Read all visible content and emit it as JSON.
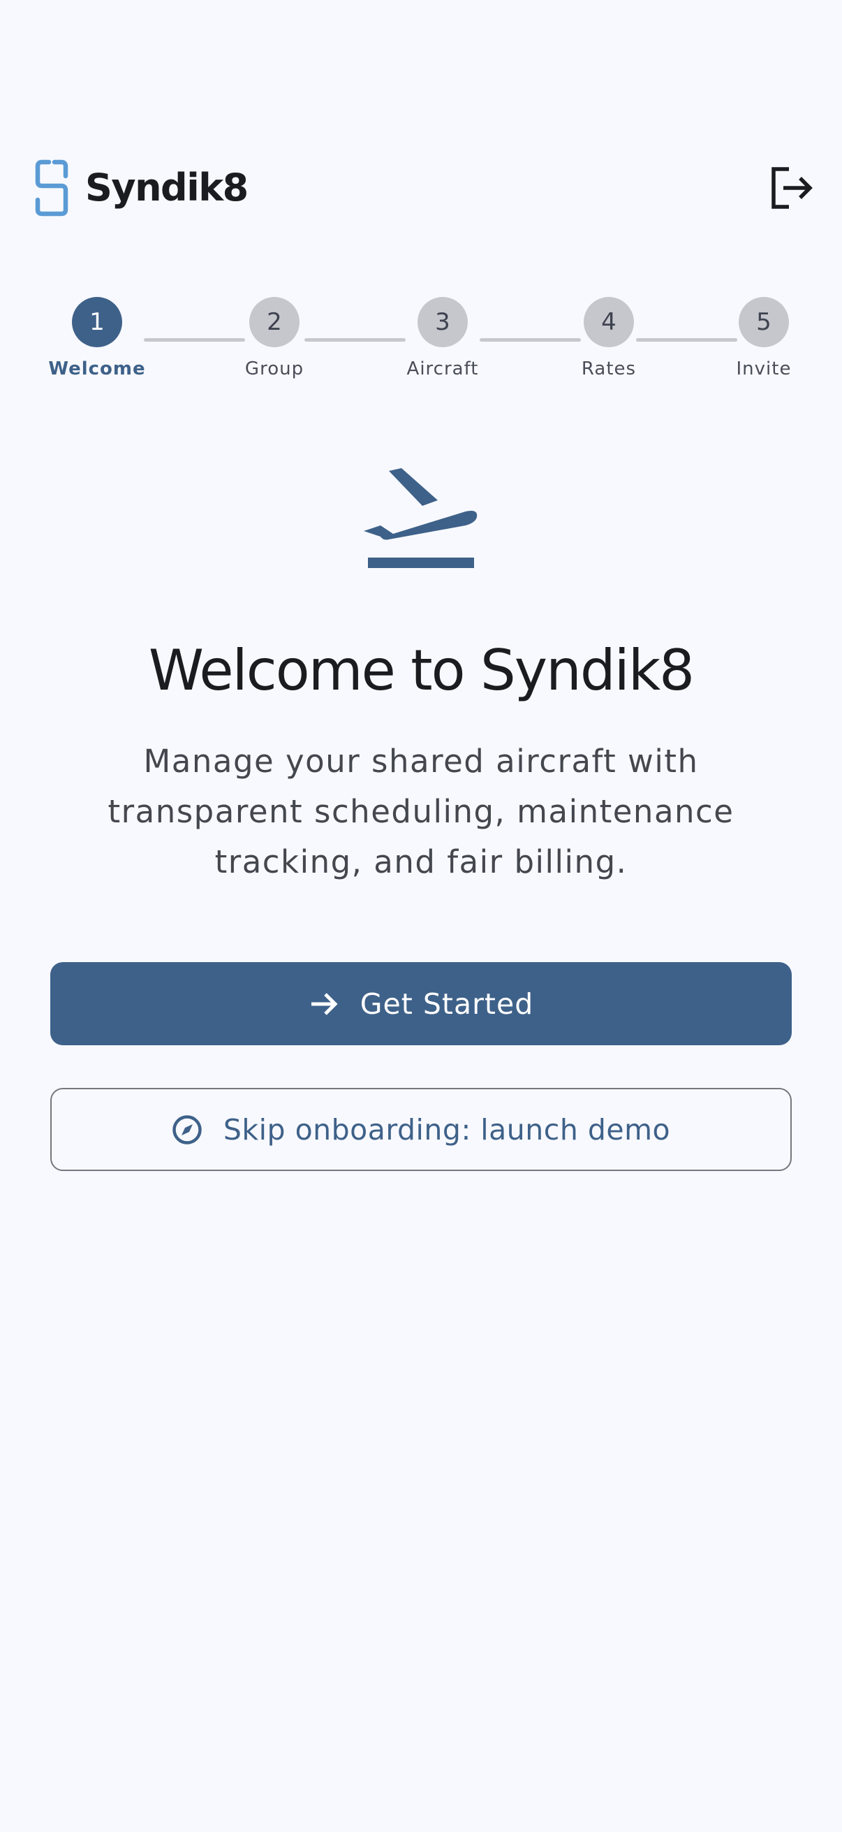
{
  "header": {
    "brand": "Syndik8",
    "logo_icon": "syndik8-logo-icon",
    "logout_icon": "logout-icon"
  },
  "stepper": {
    "steps": [
      {
        "number": "1",
        "label": "Welcome",
        "active": true
      },
      {
        "number": "2",
        "label": "Group",
        "active": false
      },
      {
        "number": "3",
        "label": "Aircraft",
        "active": false
      },
      {
        "number": "4",
        "label": "Rates",
        "active": false
      },
      {
        "number": "5",
        "label": "Invite",
        "active": false
      }
    ]
  },
  "hero": {
    "icon": "flight-takeoff-icon",
    "title": "Welcome to Syndik8",
    "subtitle": "Manage your shared aircraft with transparent scheduling, maintenance tracking, and fair billing."
  },
  "actions": {
    "primary_label": "Get Started",
    "primary_icon": "arrow-right-icon",
    "secondary_label": "Skip onboarding: launch demo",
    "secondary_icon": "compass-icon"
  },
  "colors": {
    "primary": "#3e6189",
    "background": "#f8f9fe",
    "inactive_step": "#c5c7cc",
    "logo_accent": "#5b9bd5"
  }
}
